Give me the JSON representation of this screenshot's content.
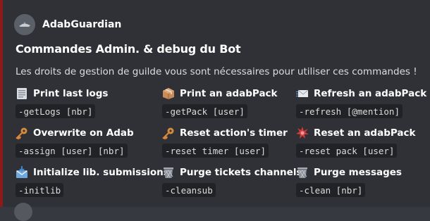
{
  "author": {
    "name": "AdabGuardian"
  },
  "embed": {
    "title": "Commandes Admin. & debug du Bot",
    "description": "Les droits de gestion de guilde vous sont nécessaires pour utiliser ces commandes !",
    "accent_color": "#8b1a1a"
  },
  "fields": [
    {
      "icon": "log-icon",
      "name": "Print last logs",
      "value": "-getLogs [nbr]"
    },
    {
      "icon": "package-icon",
      "name": "Print an adabPack",
      "value": "-getPack [user]"
    },
    {
      "icon": "envelope-icon",
      "name": "Refresh an adabPack",
      "value": "-refresh [@mention]"
    },
    {
      "icon": "key-icon",
      "name": "Overwrite on Adab",
      "value": "-assign [user] [nbr]"
    },
    {
      "icon": "key-icon",
      "name": "Reset action's timer",
      "value": "-reset timer [user]"
    },
    {
      "icon": "boom-icon",
      "name": "Reset an adabPack",
      "value": "-reset pack [user]"
    },
    {
      "icon": "inbox-icon",
      "name": "Initialize lib. submissions",
      "value": "-initlib"
    },
    {
      "icon": "wastebasket-icon",
      "name": "Purge tickets channels",
      "value": "-cleansub"
    },
    {
      "icon": "wastebasket-icon",
      "name": "Purge messages",
      "value": "-clean [nbr]"
    }
  ]
}
